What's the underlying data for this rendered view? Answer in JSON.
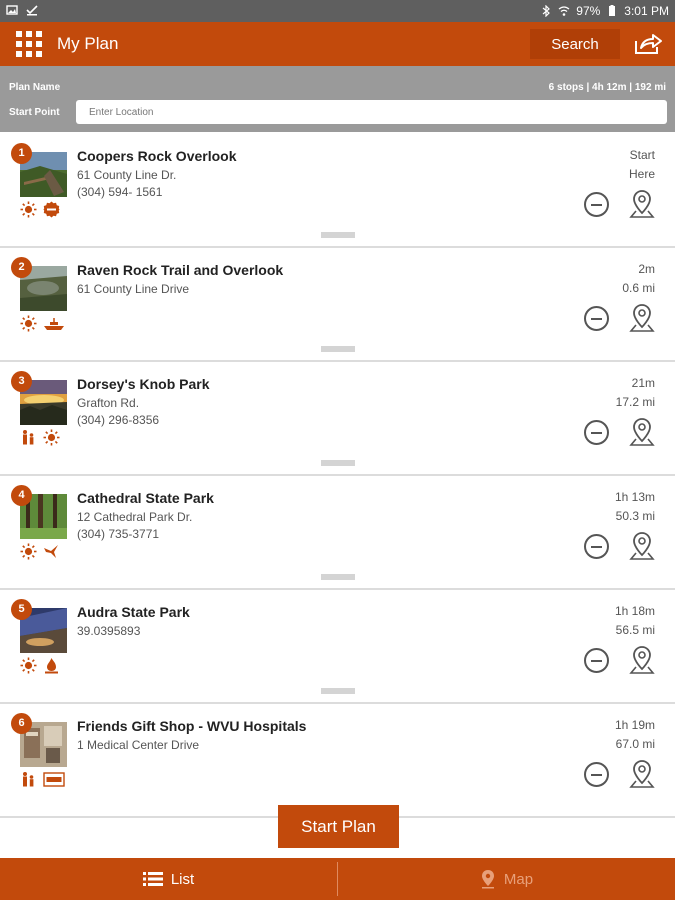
{
  "status_bar": {
    "battery": "97%",
    "time": "3:01 PM"
  },
  "app_bar": {
    "title": "My Plan",
    "search_label": "Search"
  },
  "plan": {
    "name_label": "Plan Name",
    "summary": "6 stops | 4h 12m | 192 mi",
    "start_label": "Start Point",
    "start_placeholder": "Enter Location"
  },
  "stops": [
    {
      "number": "1",
      "name": "Coopers Rock Overlook",
      "line1": "61 County Line Dr.",
      "line2": "(304) 594- 1561",
      "time": "Start",
      "distance": "Here"
    },
    {
      "number": "2",
      "name": "Raven Rock Trail and Overlook",
      "line1": "61 County Line Drive",
      "line2": "",
      "time": "2m",
      "distance": "0.6 mi"
    },
    {
      "number": "3",
      "name": "Dorsey's Knob Park",
      "line1": "Grafton Rd.",
      "line2": "(304) 296-8356",
      "time": "21m",
      "distance": "17.2 mi"
    },
    {
      "number": "4",
      "name": "Cathedral State Park",
      "line1": "12 Cathedral Park Dr.",
      "line2": "(304) 735-3771",
      "time": "1h 13m",
      "distance": "50.3 mi"
    },
    {
      "number": "5",
      "name": "Audra State Park",
      "line1": "39.0395893",
      "line2": "",
      "time": "1h 18m",
      "distance": "56.5 mi"
    },
    {
      "number": "6",
      "name": "Friends Gift Shop - WVU Hospitals",
      "line1": "1 Medical Center Drive",
      "line2": "",
      "time": "1h 19m",
      "distance": "67.0 mi"
    }
  ],
  "start_plan_label": "Start Plan",
  "tabs": {
    "list_label": "List",
    "map_label": "Map"
  },
  "colors": {
    "brand": "#c24a0c",
    "header_gray": "#9a9a9a",
    "status_gray": "#5f5f5f"
  }
}
